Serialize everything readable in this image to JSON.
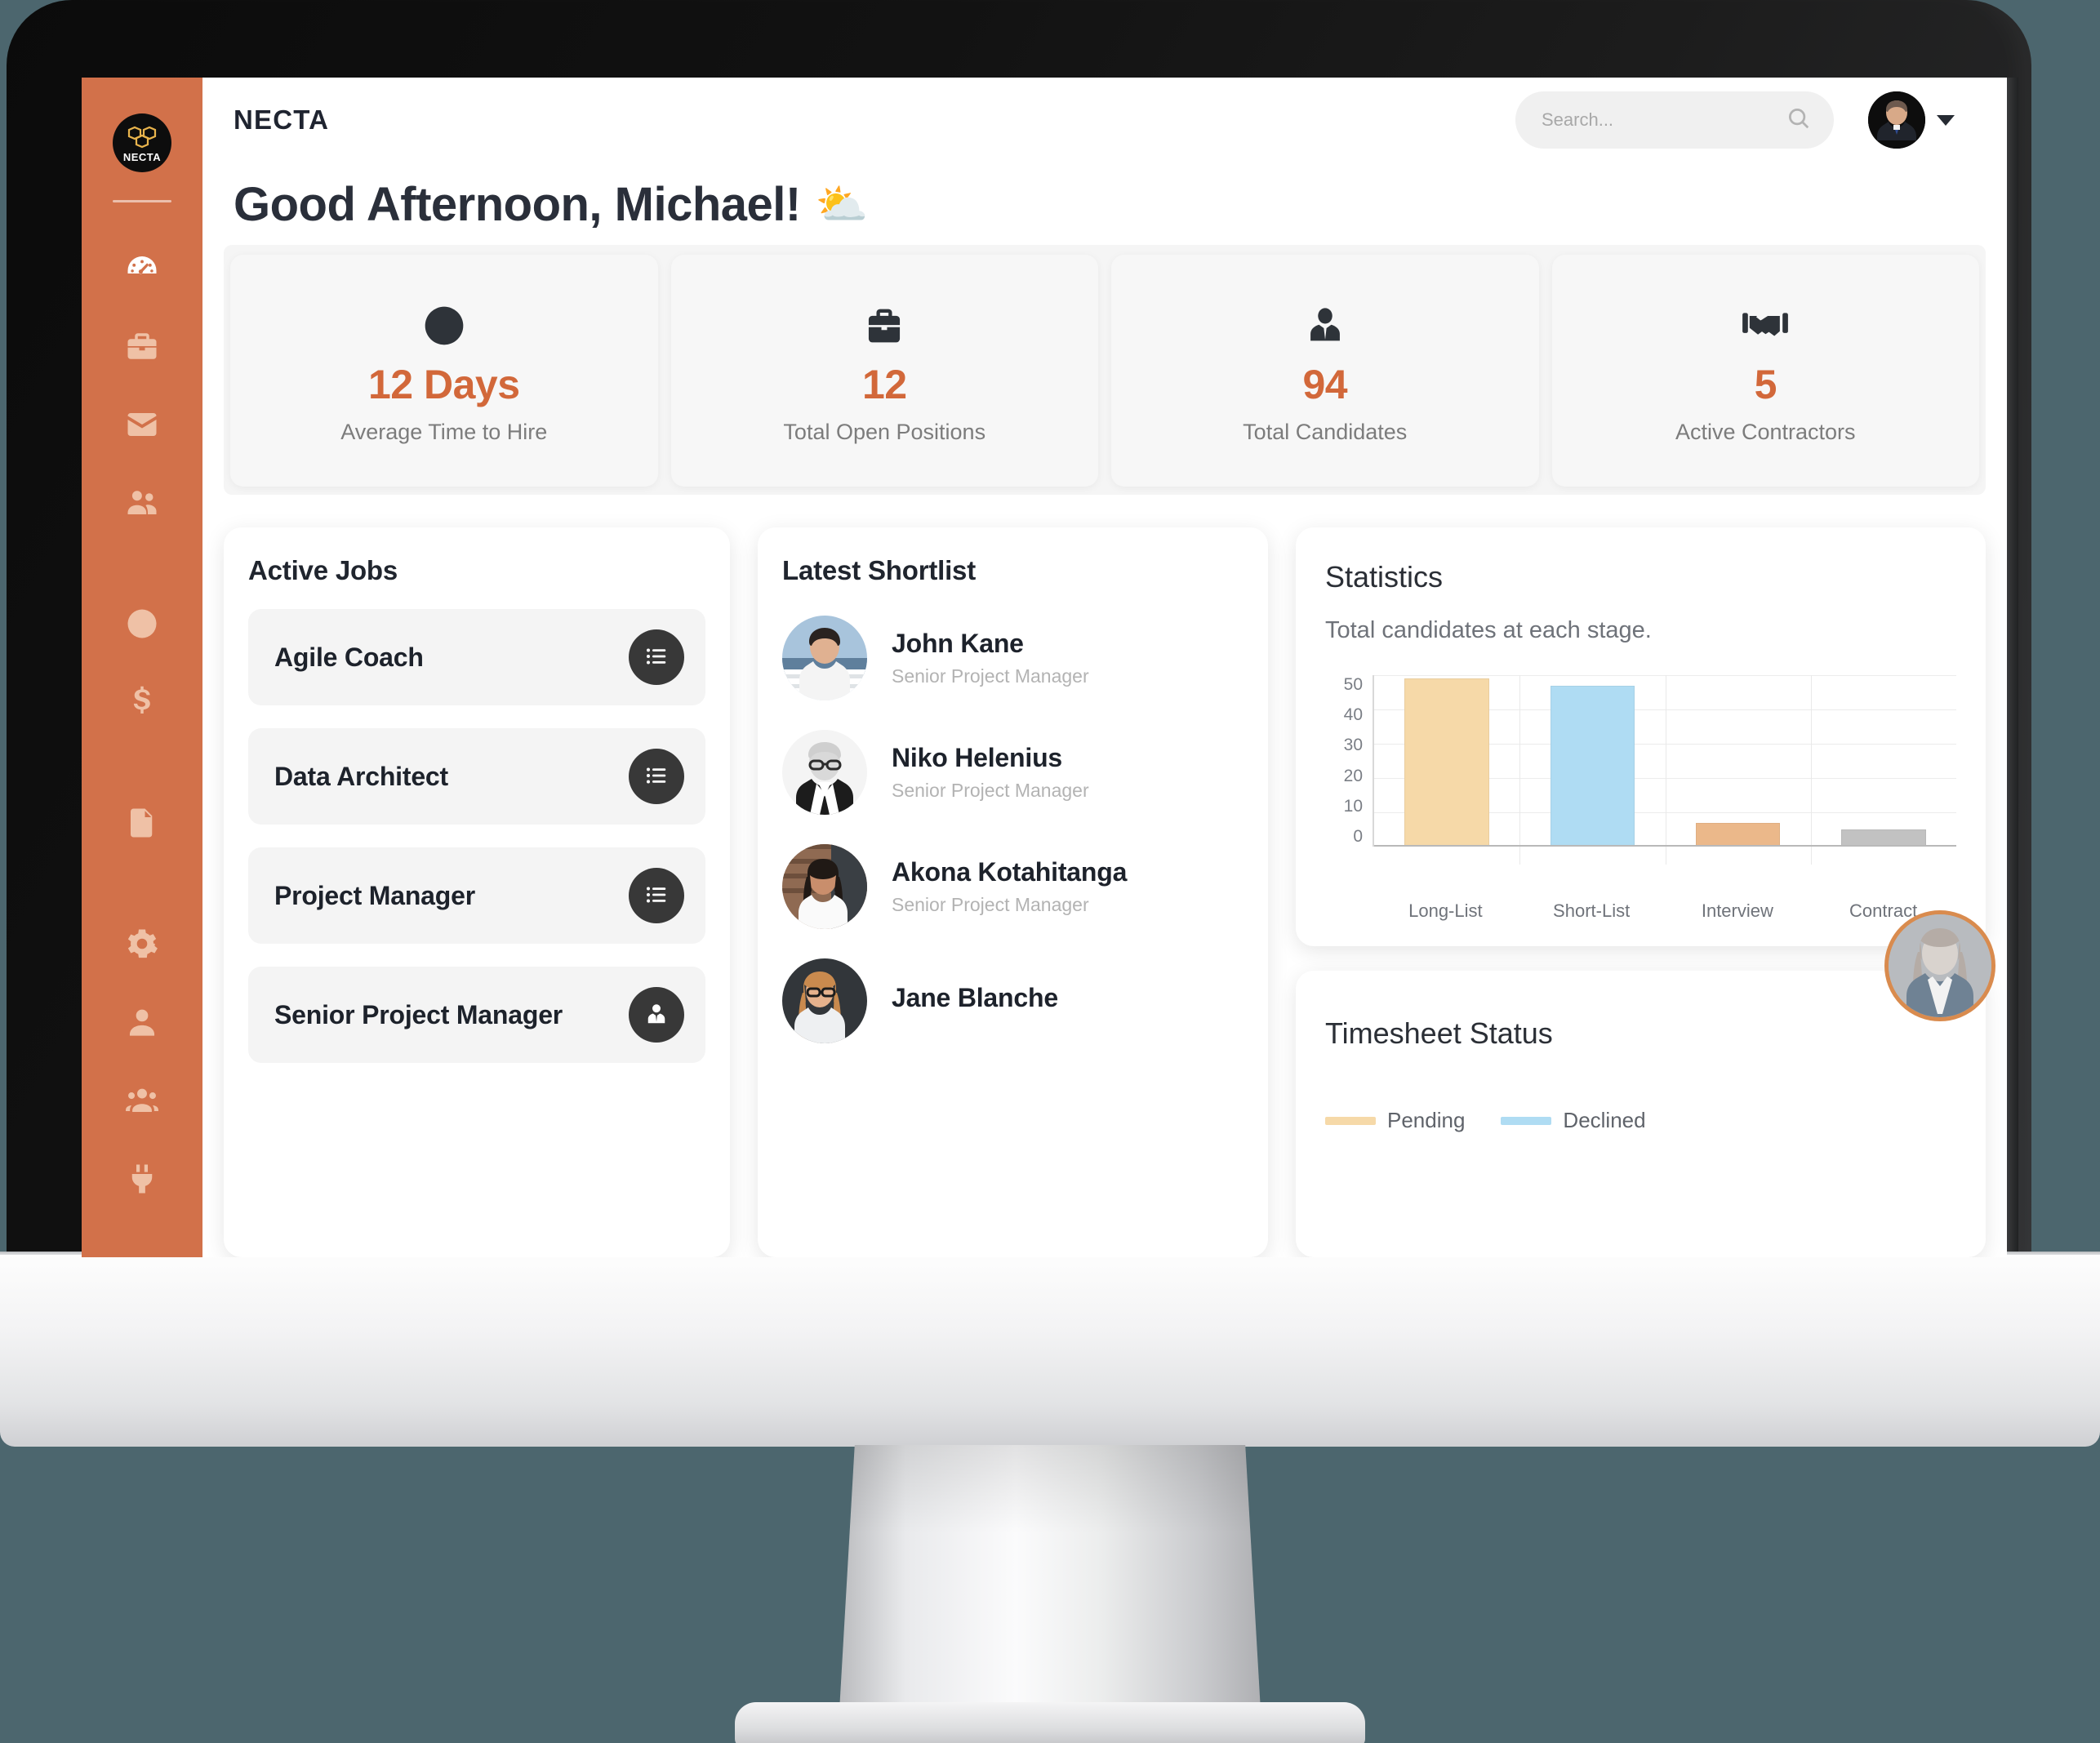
{
  "brand": {
    "name": "NECTA",
    "logo_word": "NECTA"
  },
  "search": {
    "placeholder": "Search...",
    "value": ""
  },
  "greeting": {
    "text": "Good Afternoon, Michael!",
    "emoji": "⛅"
  },
  "sidebar": {
    "items": [
      {
        "icon": "dashboard-gauge-icon",
        "active": true
      },
      {
        "icon": "briefcase-icon",
        "active": false
      },
      {
        "icon": "envelope-icon",
        "active": false
      },
      {
        "icon": "people-icon",
        "active": false
      },
      {
        "icon": "clock-icon",
        "active": false
      },
      {
        "icon": "dollar-icon",
        "active": false
      },
      {
        "icon": "document-icon",
        "active": false
      },
      {
        "icon": "gear-icon",
        "active": false
      },
      {
        "icon": "user-icon",
        "active": false
      },
      {
        "icon": "users-group-icon",
        "active": false
      },
      {
        "icon": "plug-icon",
        "active": false
      }
    ]
  },
  "stats": [
    {
      "icon": "clock-icon",
      "value": "12 Days",
      "label": "Average Time to Hire"
    },
    {
      "icon": "briefcase-icon",
      "value": "12",
      "label": "Total Open Positions"
    },
    {
      "icon": "person-tie-icon",
      "value": "94",
      "label": "Total Candidates"
    },
    {
      "icon": "handshake-icon",
      "value": "5",
      "label": "Active Contractors"
    }
  ],
  "active_jobs": {
    "title": "Active Jobs",
    "items": [
      {
        "name": "Agile Coach",
        "action_icon": "list-icon"
      },
      {
        "name": "Data Architect",
        "action_icon": "list-icon"
      },
      {
        "name": "Project Manager",
        "action_icon": "list-icon"
      },
      {
        "name": "Senior Project Manager",
        "action_icon": "person-tie-icon"
      }
    ]
  },
  "shortlist": {
    "title": "Latest Shortlist",
    "items": [
      {
        "name": "John Kane",
        "role": "Senior Project Manager"
      },
      {
        "name": "Niko Helenius",
        "role": "Senior Project Manager"
      },
      {
        "name": "Akona Kotahitanga",
        "role": "Senior Project Manager"
      },
      {
        "name": "Jane Blanche",
        "role": ""
      }
    ]
  },
  "statistics": {
    "title": "Statistics",
    "subtitle": "Total candidates at each stage."
  },
  "chart_data": {
    "type": "bar",
    "title": "Statistics",
    "subtitle": "Total candidates at each stage.",
    "categories": [
      "Long-List",
      "Short-List",
      "Interview",
      "Contract"
    ],
    "values": [
      49,
      47,
      7,
      5
    ],
    "colors": [
      "#F6D9A8",
      "#AFDCF3",
      "#EBB88A",
      "#C2C2C2"
    ],
    "xlabel": "",
    "ylabel": "",
    "ylim": [
      0,
      50
    ],
    "yticks": [
      50,
      40,
      30,
      20,
      10,
      0
    ],
    "grid": true,
    "legend": "none"
  },
  "timesheet": {
    "title": "Timesheet Status",
    "legend": [
      {
        "label": "Pending",
        "color": "#F6D9A8"
      },
      {
        "label": "Declined",
        "color": "#AFDCF3"
      }
    ]
  },
  "colors": {
    "sidebar": "#D2714A",
    "accent": "#D2683A",
    "background": "#4C666E",
    "text_dark": "#20252e"
  }
}
